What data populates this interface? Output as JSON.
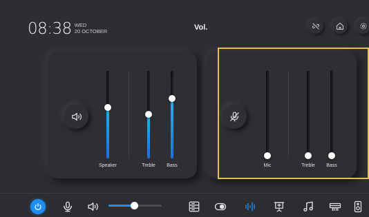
{
  "header": {
    "time": "08:38",
    "weekday": "WED",
    "date": "20 OCTOBER",
    "title": "Vol.",
    "buttons": [
      {
        "name": "unlink-icon",
        "label": "unlink"
      },
      {
        "name": "home-icon",
        "label": "home"
      },
      {
        "name": "settings-icon",
        "label": "settings"
      }
    ]
  },
  "speaker_panel": {
    "icon": "speaker-icon",
    "sliders": [
      {
        "label": "Speaker",
        "level": 0.58
      },
      {
        "label": "Treble",
        "level": 0.49
      },
      {
        "label": "Bass",
        "level": 0.66
      }
    ]
  },
  "mic_panel": {
    "icon": "mic-muted-icon",
    "sliders": [
      {
        "label": "Mic",
        "level": 0.0
      },
      {
        "label": "Treble",
        "level": 0.0
      },
      {
        "label": "Bass",
        "level": 0.0
      }
    ]
  },
  "dock": {
    "volume_level": 0.45,
    "items": [
      "power-icon",
      "mic-icon",
      "speaker-icon",
      "volume-slider",
      "display-source-icon",
      "toggle-icon",
      "equalizer-icon",
      "presentation-icon",
      "music-icon",
      "printer-icon",
      "speaker-device-icon"
    ],
    "accent": "#1d8ef0"
  },
  "colors": {
    "background": "#2d2e32",
    "highlight": "#e6c14d",
    "slider_fill": "#1fb4ea"
  }
}
